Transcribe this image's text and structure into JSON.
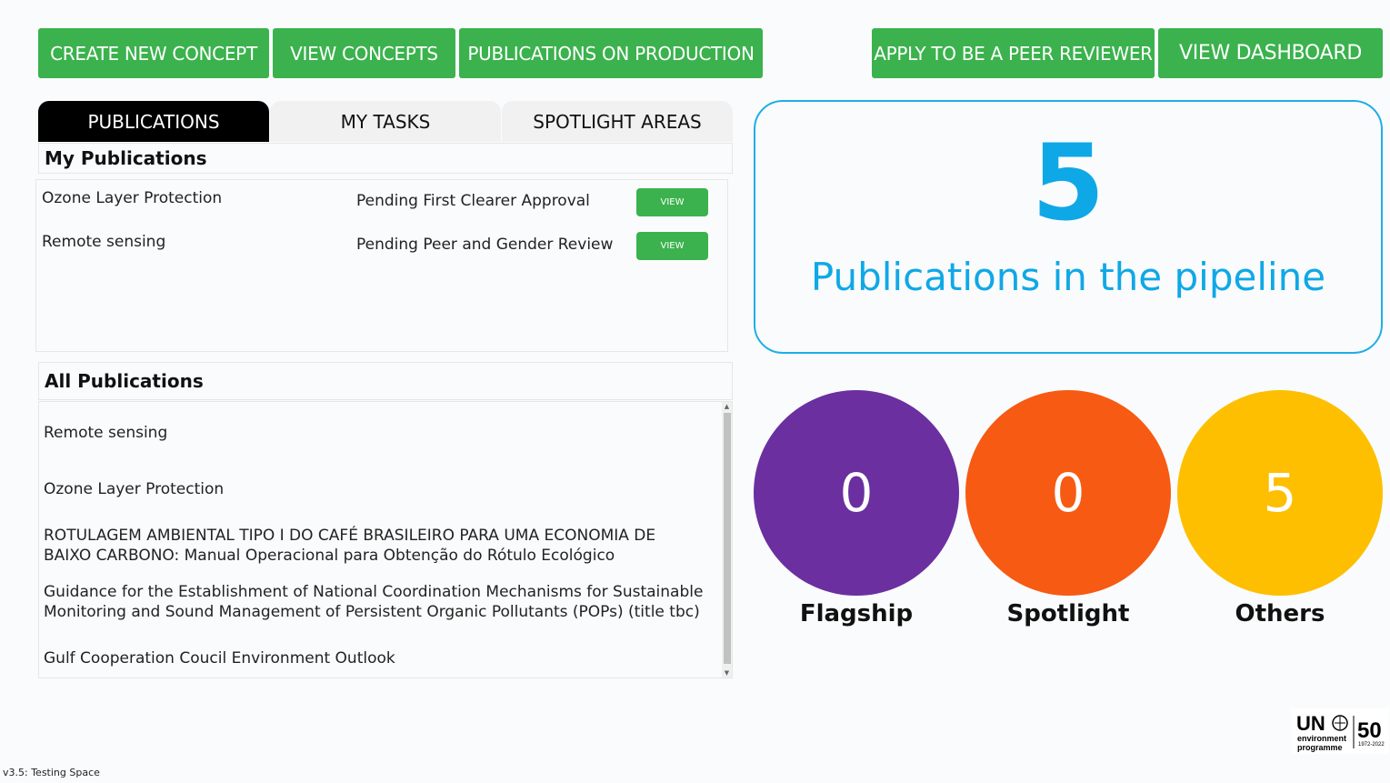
{
  "toolbar": {
    "create_concept": "CREATE NEW CONCEPT",
    "view_concepts": "VIEW CONCEPTS",
    "publications_on_production": "PUBLICATIONS ON PRODUCTION",
    "apply_peer_reviewer": "APPLY TO BE A PEER REVIEWER",
    "view_dashboard": "VIEW DASHBOARD"
  },
  "tabs": [
    {
      "label": "PUBLICATIONS",
      "active": true
    },
    {
      "label": "MY TASKS",
      "active": false
    },
    {
      "label": "SPOTLIGHT AREAS",
      "active": false
    }
  ],
  "my_publications": {
    "heading": "My Publications",
    "items": [
      {
        "title": "Ozone Layer Protection",
        "status": "Pending First Clearer Approval",
        "action": "VIEW"
      },
      {
        "title": "Remote sensing",
        "status": "Pending Peer and Gender Review",
        "action": "VIEW"
      }
    ]
  },
  "all_publications": {
    "heading": "All Publications",
    "items": [
      "Remote sensing",
      "Ozone Layer Protection",
      "ROTULAGEM AMBIENTAL TIPO I DO CAFÉ BRASILEIRO PARA UMA ECONOMIA DE BAIXO CARBONO: Manual Operacional para Obtenção do Rótulo Ecológico",
      "Guidance for the Establishment of National Coordination Mechanisms for Sustainable Monitoring and Sound Management of Persistent Organic Pollutants (POPs) (title tbc)",
      "Gulf Cooperation Coucil  Environment Outlook"
    ]
  },
  "pipeline": {
    "count": "5",
    "label": "Publications in the pipeline"
  },
  "categories": [
    {
      "value": "0",
      "label": "Flagship",
      "color": "#6b2fa0"
    },
    {
      "value": "0",
      "label": "Spotlight",
      "color": "#f75a12"
    },
    {
      "value": "5",
      "label": "Others",
      "color": "#fdbf00"
    }
  ],
  "colors": {
    "button_green": "#3bb24d",
    "accent_blue": "#0fa8e6"
  },
  "logo": {
    "text_un": "UN",
    "text_environment": "environment",
    "text_programme": "programme",
    "text_years": "1972-2022",
    "text_fifty": "50"
  },
  "footer": {
    "version": "v3.5: Testing Space"
  }
}
